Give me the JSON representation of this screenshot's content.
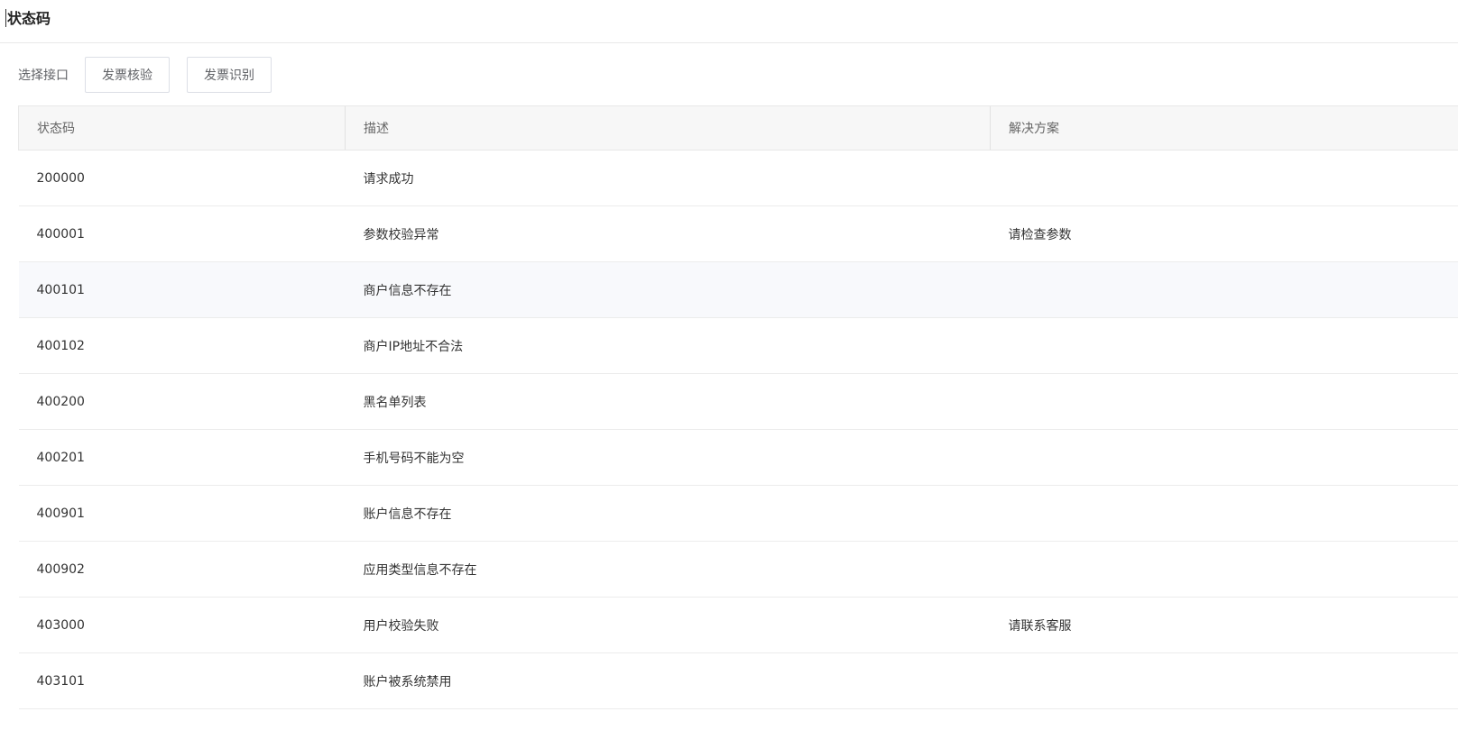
{
  "page": {
    "title": "状态码"
  },
  "toolbar": {
    "label": "选择接口",
    "buttons": [
      "发票核验",
      "发票识别"
    ]
  },
  "table": {
    "headers": [
      "状态码",
      "描述",
      "解决方案"
    ],
    "rows": [
      {
        "code": "200000",
        "desc": "请求成功",
        "solution": ""
      },
      {
        "code": "400001",
        "desc": "参数校验异常",
        "solution": "请检查参数"
      },
      {
        "code": "400101",
        "desc": "商户信息不存在",
        "solution": ""
      },
      {
        "code": "400102",
        "desc": "商户IP地址不合法",
        "solution": ""
      },
      {
        "code": "400200",
        "desc": "黑名单列表",
        "solution": ""
      },
      {
        "code": "400201",
        "desc": "手机号码不能为空",
        "solution": ""
      },
      {
        "code": "400901",
        "desc": "账户信息不存在",
        "solution": ""
      },
      {
        "code": "400902",
        "desc": "应用类型信息不存在",
        "solution": ""
      },
      {
        "code": "403000",
        "desc": "用户校验失败",
        "solution": "请联系客服"
      },
      {
        "code": "403101",
        "desc": "账户被系统禁用",
        "solution": ""
      }
    ]
  }
}
